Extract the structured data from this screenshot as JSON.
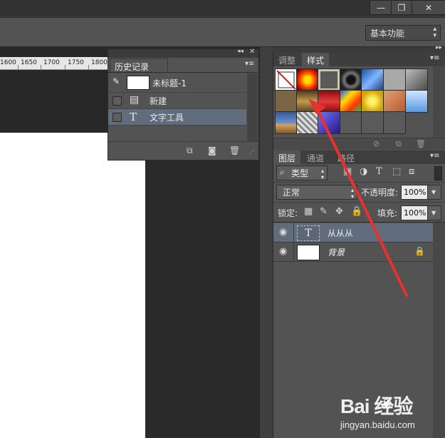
{
  "window": {
    "minimize_glyph": "—",
    "restore_glyph": "❐",
    "close_glyph": "✕"
  },
  "options_bar": {
    "workspace": "基本功能"
  },
  "ruler": {
    "ticks": [
      "1600",
      "1650",
      "1700",
      "1750",
      "1800"
    ]
  },
  "history_panel": {
    "tab_label": "历史记录",
    "snapshot_name": "未标题-1",
    "items": [
      {
        "label": "新建",
        "icon": "document-icon"
      },
      {
        "label": "文字工具",
        "icon": "type-tool-icon"
      }
    ]
  },
  "styles_panel": {
    "tabs": [
      "调整",
      "样式"
    ],
    "active_tab": "样式",
    "swatch_count": 19
  },
  "layers_panel": {
    "tabs": [
      "图层",
      "通道",
      "路径"
    ],
    "active_tab": "图层",
    "filter_kind": "类型",
    "blend_mode": "正常",
    "opacity_label": "不透明度:",
    "opacity_value": "100%",
    "lock_label": "锁定:",
    "fill_label": "填充:",
    "fill_value": "100%",
    "layers": [
      {
        "name": "从从从",
        "kind": "text",
        "selected": true
      },
      {
        "name": "背景",
        "kind": "background",
        "locked": true
      }
    ]
  },
  "watermark": {
    "brand": "Bai  经验",
    "url": "jingyan.baidu.com"
  },
  "colors": {
    "selection": "#616d7d",
    "annotation_arrow": "#e8312f"
  }
}
